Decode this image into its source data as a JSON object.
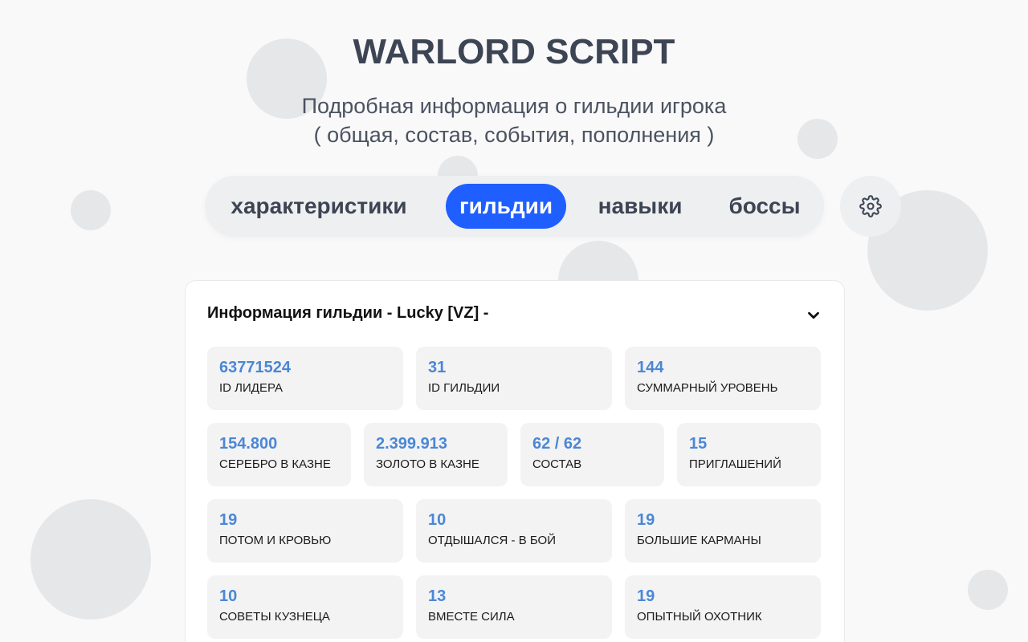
{
  "app": {
    "title": "WARLORD SCRIPT",
    "subtitle_line1": "Подробная информация о гильдии игрока",
    "subtitle_line2": "( общая, состав, события, пополнения )"
  },
  "tabs": [
    {
      "label": "характеристики",
      "active": false
    },
    {
      "label": "гильдии",
      "active": true
    },
    {
      "label": "навыки",
      "active": false
    },
    {
      "label": "боссы",
      "active": false
    }
  ],
  "settings": {
    "icon": "gear-icon"
  },
  "guild_card": {
    "header": "Информация гильдии - Lucky [VZ] -",
    "collapse_icon": "chevron-down-icon",
    "stats": [
      {
        "value": "63771524",
        "label": "ID ЛИДЕРА"
      },
      {
        "value": "31",
        "label": "ID ГИЛЬДИИ"
      },
      {
        "value": "144",
        "label": "СУММАРНЫЙ УРОВЕНЬ"
      },
      {
        "value": "154.800",
        "label": "СЕРЕБРО В КАЗНЕ"
      },
      {
        "value": "2.399.913",
        "label": "ЗОЛОТО В КАЗНЕ"
      },
      {
        "value": "62 / 62",
        "label": "СОСТАВ"
      },
      {
        "value": "15",
        "label": "ПРИГЛАШЕНИЙ"
      },
      {
        "value": "19",
        "label": "ПОТОМ И КРОВЬЮ"
      },
      {
        "value": "10",
        "label": "ОТДЫШАЛСЯ - В БОЙ"
      },
      {
        "value": "19",
        "label": "БОЛЬШИЕ КАРМАНЫ"
      },
      {
        "value": "10",
        "label": "СОВЕТЫ КУЗНЕЦА"
      },
      {
        "value": "13",
        "label": "ВМЕСТЕ СИЛА"
      },
      {
        "value": "19",
        "label": "ОПЫТНЫЙ ОХОТНИК"
      }
    ]
  },
  "colors": {
    "accent": "#1f5fff",
    "value_text": "#4a87d6",
    "title_text": "#3d4554",
    "background": "#f9f9fa"
  }
}
